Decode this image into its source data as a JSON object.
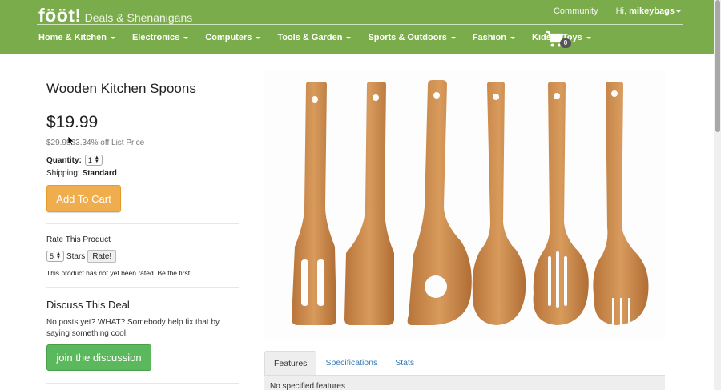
{
  "header": {
    "logo": "fööt!",
    "tagline": "Deals & Shenanigans",
    "community": "Community",
    "greeting": "Hi,",
    "username": "mikeybags",
    "nav": [
      "Home & Kitchen",
      "Electronics",
      "Computers",
      "Tools & Garden",
      "Sports & Outdoors",
      "Fashion",
      "Kids & Toys"
    ],
    "cart_count": "0",
    "cart_icon": "shopping-cart-icon"
  },
  "product": {
    "title": "Wooden Kitchen Spoons",
    "price": "$19.99",
    "list_price": "$29.99",
    "discount_text": "33.34% off List Price",
    "quantity_label": "Quantity:",
    "quantity_value": "1",
    "shipping_label": "Shipping:",
    "shipping_value": "Standard",
    "add_to_cart": "Add To Cart"
  },
  "rating": {
    "title": "Rate This Product",
    "stars_value": "5",
    "stars_label": "Stars",
    "rate_button": "Rate!",
    "note": "This product has not yet been rated. Be the first!"
  },
  "discussion": {
    "title": "Discuss This Deal",
    "text": "No posts yet? WHAT? Somebody help fix that by saying something cool.",
    "button": "join the discussion"
  },
  "tabs": {
    "items": [
      "Features",
      "Specifications",
      "Stats"
    ],
    "active": "Features",
    "content": "No specified features"
  },
  "colors": {
    "header_bg": "#7bac4b",
    "add_to_cart": "#f0ad4e",
    "join_button": "#5cb85c",
    "link": "#337ab7",
    "wood": "#c98a4b"
  }
}
